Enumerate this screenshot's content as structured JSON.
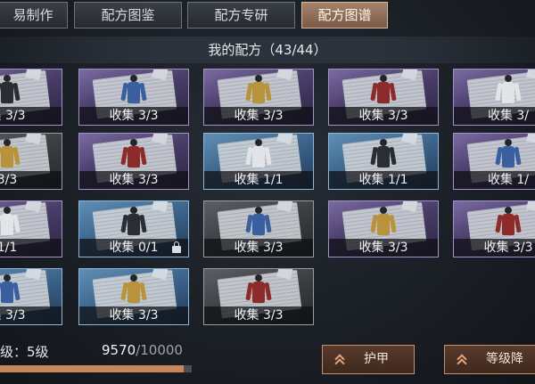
{
  "tabs": [
    {
      "label": "易制作",
      "active": false
    },
    {
      "label": "配方图鉴",
      "active": false
    },
    {
      "label": "配方专研",
      "active": false
    },
    {
      "label": "配方图谱",
      "active": true
    }
  ],
  "header": {
    "title": "我的配方（43/44）"
  },
  "grid": {
    "rows": [
      [
        {
          "label": "集 3/3",
          "rarity": "purple",
          "locked": false
        },
        {
          "label": "收集 3/3",
          "rarity": "purple",
          "locked": false
        },
        {
          "label": "收集 3/3",
          "rarity": "purple",
          "locked": false
        },
        {
          "label": "收集 3/3",
          "rarity": "purple",
          "locked": false
        },
        {
          "label": "收集 3/",
          "rarity": "purple",
          "locked": false
        }
      ],
      [
        {
          "label": "3/3",
          "rarity": "gray",
          "locked": false
        },
        {
          "label": "收集 3/3",
          "rarity": "purple",
          "locked": false
        },
        {
          "label": "收集 1/1",
          "rarity": "blue",
          "locked": false
        },
        {
          "label": "收集 1/1",
          "rarity": "blue",
          "locked": false
        },
        {
          "label": "收集 1/",
          "rarity": "purple",
          "locked": false
        }
      ],
      [
        {
          "label": "1/1",
          "rarity": "purple",
          "locked": false
        },
        {
          "label": "收集 0/1",
          "rarity": "blue",
          "locked": true
        },
        {
          "label": "收集 3/3",
          "rarity": "gray",
          "locked": false
        },
        {
          "label": "收集 3/3",
          "rarity": "purple",
          "locked": false
        },
        {
          "label": "收集 3/3",
          "rarity": "purple",
          "locked": false
        }
      ],
      [
        {
          "label": "集 3/3",
          "rarity": "blue",
          "locked": false
        },
        {
          "label": "收集 3/3",
          "rarity": "blue",
          "locked": false
        },
        {
          "label": "收集 3/3",
          "rarity": "gray",
          "locked": false
        }
      ]
    ]
  },
  "footer": {
    "level_text": "级：5级",
    "exp_current": "9570",
    "exp_separator": "/",
    "exp_max": "10000",
    "exp_fraction": 0.957,
    "armor_button": "护甲",
    "level_button": "等级降"
  },
  "colors": {
    "accent": "#c7875a",
    "purple_card": "#5a4d80",
    "blue_card": "#4a76a0",
    "gray_card": "#45474b"
  },
  "icons": {
    "lock": "lock-icon",
    "buttons": "double-chevron-up-icon"
  }
}
